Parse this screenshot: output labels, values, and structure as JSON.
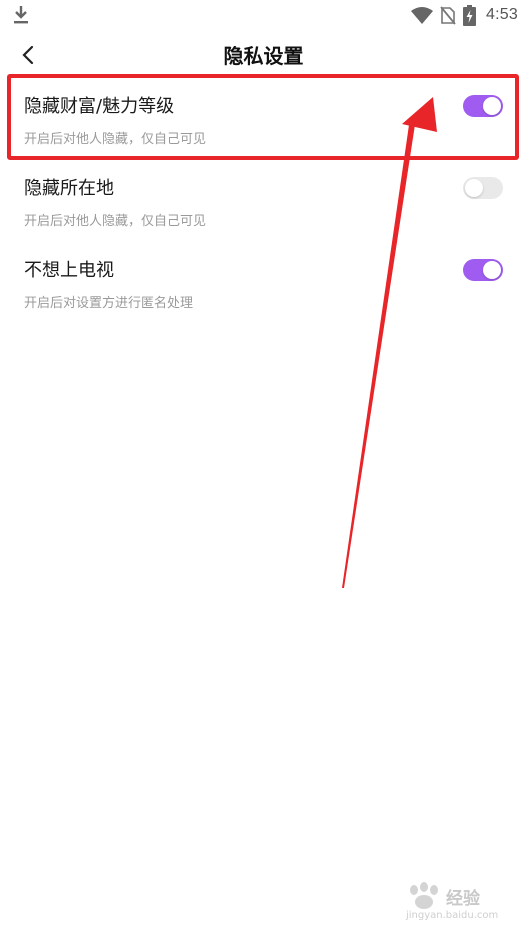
{
  "status_bar": {
    "time": "4:53",
    "icons": [
      "download-icon",
      "wifi-icon",
      "no-sim-icon",
      "battery-icon"
    ]
  },
  "header": {
    "title": "隐私设置",
    "back_icon": "chevron-left-icon"
  },
  "settings": [
    {
      "title": "隐藏财富/魅力等级",
      "description": "开启后对他人隐藏，仅自己可见",
      "enabled": true
    },
    {
      "title": "隐藏所在地",
      "description": "开启后对他人隐藏，仅自己可见",
      "enabled": false
    },
    {
      "title": "不想上电视",
      "description": "开启后对设置方进行匿名处理",
      "enabled": true
    }
  ],
  "colors": {
    "toggle_on": "#a05cf0",
    "toggle_off": "#e9e9e9",
    "annotation_red": "#e8262a"
  },
  "watermark": {
    "brand": "经验",
    "url": "jingyan.baidu.com"
  }
}
